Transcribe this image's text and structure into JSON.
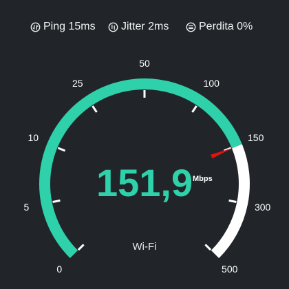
{
  "stats": {
    "ping": "Ping 15ms",
    "jitter": "Jitter 2ms",
    "loss": "Perdita 0%"
  },
  "gauge": {
    "speed": "151,9",
    "unit": "Mbps",
    "connection": "Wi-Fi",
    "scale_labels": [
      "0",
      "5",
      "10",
      "25",
      "50",
      "100",
      "150",
      "300",
      "500"
    ],
    "needle_value": "151,9",
    "colors": {
      "background": "#212529",
      "accent": "#2ed1aa",
      "track": "#ffffff",
      "needle": "#e0140f"
    }
  }
}
